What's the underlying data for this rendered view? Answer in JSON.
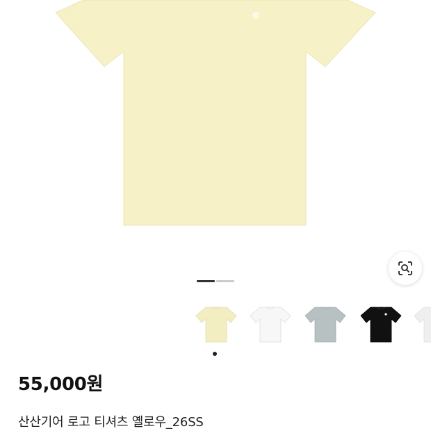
{
  "product": {
    "price": "55,000원",
    "title": "산산기어 로고 티셔츠 옐로우_26SS",
    "main_color": "#f6f1c6"
  },
  "gallery": {
    "page_count": 2,
    "current_page": 1,
    "active_indicator_color": "#333333",
    "inactive_indicator_color": "#cccccc"
  },
  "lens_button": {
    "icon": "image-search-lens-icon"
  },
  "color_options": [
    {
      "name_icon": "tshirt-yellow-icon",
      "color": "#f3edc2",
      "selected": true
    },
    {
      "name_icon": "tshirt-white-icon",
      "color": "#f7f7f7",
      "selected": false
    },
    {
      "name_icon": "tshirt-gray-icon",
      "color": "#b7c1c2",
      "selected": false
    },
    {
      "name_icon": "tshirt-black-icon",
      "color": "#111111",
      "selected": false
    },
    {
      "name_icon": "tshirt-offwhite-icon",
      "color": "#efefef",
      "selected": false
    }
  ]
}
